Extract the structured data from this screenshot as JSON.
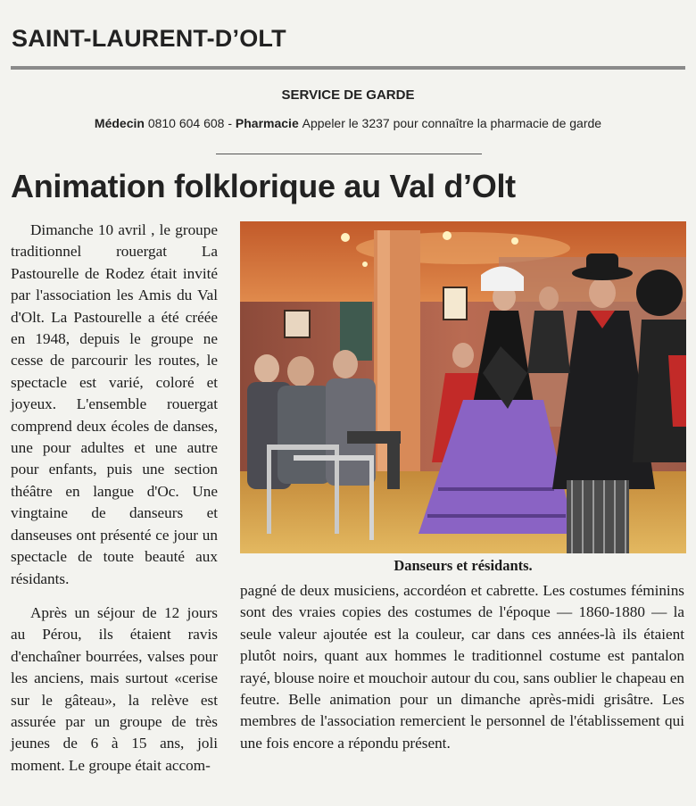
{
  "section": "SAINT-LAURENT-D’OLT",
  "garde": {
    "title": "SERVICE DE GARDE",
    "medecin_label": "Médecin",
    "medecin_number": "0810 604 608",
    "separator": " - ",
    "pharmacie_label": "Pharmacie",
    "pharmacie_text": "Appeler le 3237 pour connaître la pharmacie de garde"
  },
  "article": {
    "headline": "Animation folklorique au Val d’Olt",
    "paragraph1": "Dimanche 10 avril , le groupe traditionnel rouergat La Pastourelle de Rodez était invité par l'association les Amis du Val d'Olt. La Pastourelle a été créée en 1948, depuis le groupe ne cesse de parcourir les routes, le spectacle est varié, coloré et joyeux. L'ensemble rouergat comprend deux écoles de danses, une pour adultes et une autre pour enfants, puis une section théâtre en langue d'Oc. Une vingtaine de danseurs et danseuses ont présenté ce jour un spectacle de toute beauté aux résidants.",
    "paragraph2_left": "Après un séjour de 12 jours au Pérou, ils étaient ravis d'enchaîner bourrées, valses pour les anciens, mais surtout «cerise sur le gâteau», la relève est assurée par un groupe de très jeunes de 6 à 15 ans, joli moment. Le groupe était accom-",
    "paragraph2_right": "pagné de deux musiciens, accordéon et cabrette. Les costumes féminins sont des vraies copies des costumes de l'époque — 1860-1880 — la seule valeur ajoutée est la couleur, car dans ces années-là ils étaient plutôt noirs, quant aux hommes le traditionnel costume est pantalon rayé, blouse noire et mouchoir autour du cou, sans oublier le chapeau en feutre. Belle animation pour un dimanche après-midi grisâtre. Les membres de l'association remercient le personnel de l'établissement qui une fois encore a répondu présent.",
    "photo_caption": "Danseurs et résidants."
  },
  "colors": {
    "rule": "#8a8a8a",
    "paper": "#f3f3ef",
    "ink": "#1c1c1c",
    "dress_purple": "#8a63c4"
  }
}
